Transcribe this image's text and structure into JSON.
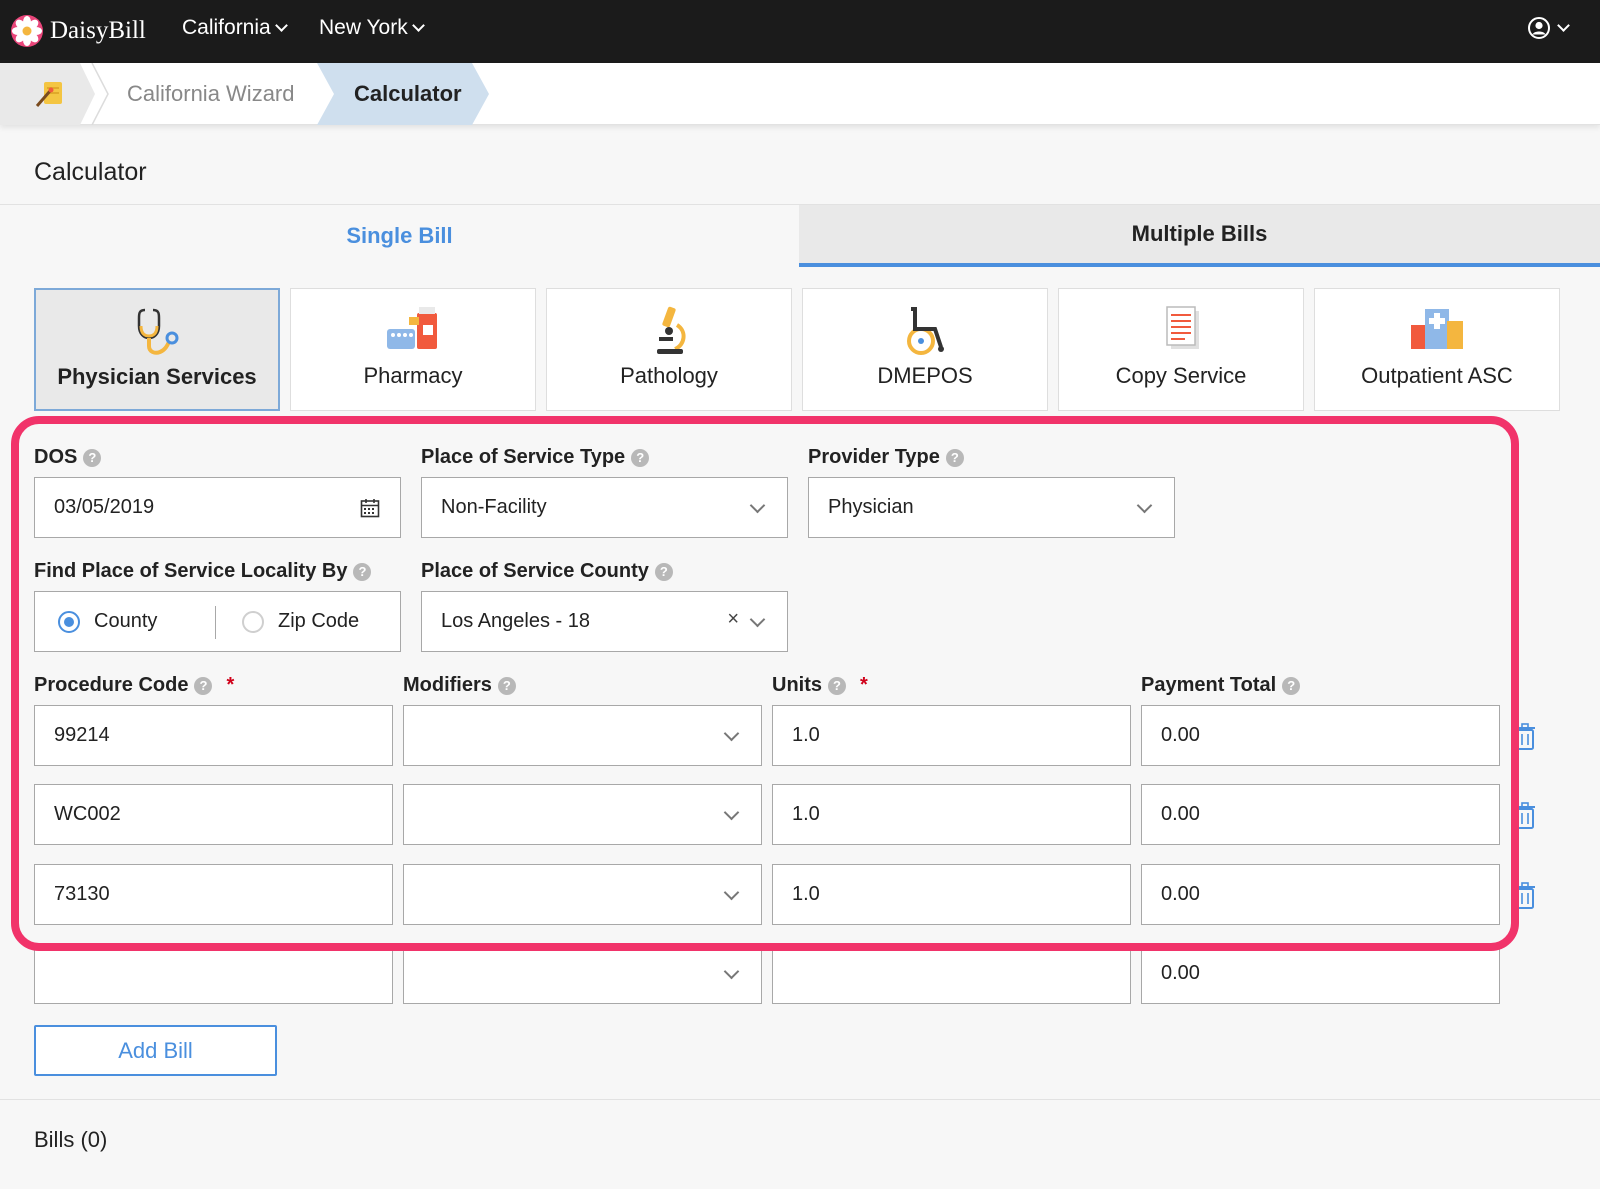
{
  "navbar": {
    "brand": "DaisyBill",
    "menus": [
      {
        "label": "California"
      },
      {
        "label": "New York"
      }
    ]
  },
  "breadcrumb": {
    "items": [
      {
        "label": "California Wizard"
      },
      {
        "label": "Calculator"
      }
    ]
  },
  "page": {
    "title": "Calculator"
  },
  "tabs": [
    {
      "label": "Single Bill",
      "active": true
    },
    {
      "label": "Multiple Bills",
      "active": false
    }
  ],
  "service_types": [
    {
      "label": "Physician Services",
      "icon": "stethoscope-icon",
      "selected": true
    },
    {
      "label": "Pharmacy",
      "icon": "pharmacy-icon",
      "selected": false
    },
    {
      "label": "Pathology",
      "icon": "microscope-icon",
      "selected": false
    },
    {
      "label": "DMEPOS",
      "icon": "wheelchair-icon",
      "selected": false
    },
    {
      "label": "Copy Service",
      "icon": "document-copy-icon",
      "selected": false
    },
    {
      "label": "Outpatient ASC",
      "icon": "hospital-icon",
      "selected": false
    }
  ],
  "form": {
    "dos": {
      "label": "DOS",
      "value": "03/05/2019"
    },
    "place_of_service_type": {
      "label": "Place of Service Type",
      "value": "Non-Facility"
    },
    "provider_type": {
      "label": "Provider Type",
      "value": "Physician"
    },
    "locality_by": {
      "label": "Find Place of Service Locality By",
      "options": [
        {
          "label": "County",
          "checked": true
        },
        {
          "label": "Zip Code",
          "checked": false
        }
      ]
    },
    "county": {
      "label": "Place of Service County",
      "value": "Los Angeles - 18",
      "clear": "×"
    },
    "columns": {
      "procedure_code": "Procedure Code",
      "modifiers": "Modifiers",
      "units": "Units",
      "payment_total": "Payment Total",
      "required_mark": "*"
    },
    "rows": [
      {
        "procedure_code": "99214",
        "modifiers": "",
        "units": "1.0",
        "payment_total": "0.00"
      },
      {
        "procedure_code": "WC002",
        "modifiers": "",
        "units": "1.0",
        "payment_total": "0.00"
      },
      {
        "procedure_code": "73130",
        "modifiers": "",
        "units": "1.0",
        "payment_total": "0.00"
      },
      {
        "procedure_code": "",
        "modifiers": "",
        "units": "",
        "payment_total": "0.00"
      }
    ]
  },
  "actions": {
    "add_bill": "Add Bill"
  },
  "bills": {
    "count_label": "Bills (0)"
  },
  "colors": {
    "accent": "#4a8fde",
    "highlight": "#f1336a",
    "navbar": "#1b1b1b"
  }
}
